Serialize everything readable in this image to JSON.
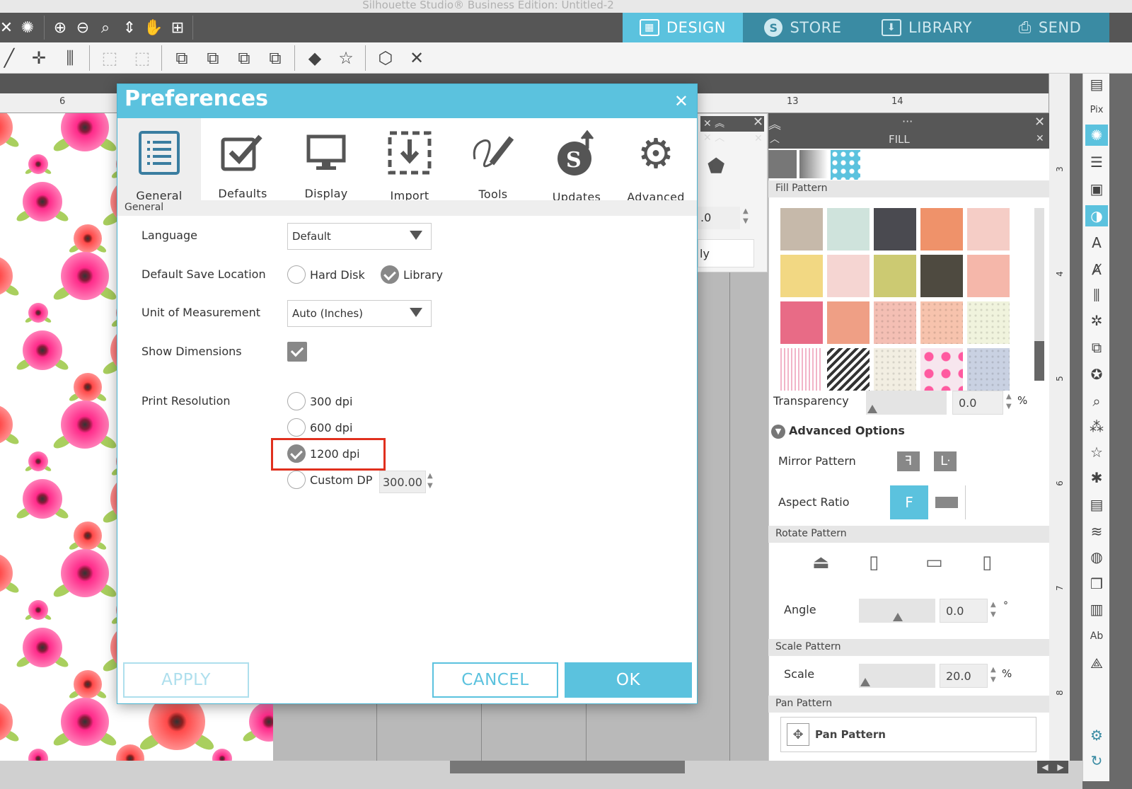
{
  "window_title": "Silhouette Studio® Business Edition: Untitled-2",
  "nav_tabs": [
    {
      "label": "DESIGN",
      "icon": "grid-icon",
      "active": true
    },
    {
      "label": "STORE",
      "icon": "store-s-icon",
      "active": false
    },
    {
      "label": "LIBRARY",
      "icon": "library-download-icon",
      "active": false
    },
    {
      "label": "SEND",
      "icon": "printer-icon",
      "active": false
    }
  ],
  "ruler": {
    "h_numbers": [
      "6",
      "13",
      "14"
    ],
    "v_numbers": [
      "3",
      "4",
      "5",
      "6",
      "7",
      "8"
    ]
  },
  "dialog": {
    "title": "Preferences",
    "tabs": [
      {
        "label": "General",
        "icon": "list-icon"
      },
      {
        "label": "Defaults",
        "icon": "checkbox-icon"
      },
      {
        "label": "Display",
        "icon": "monitor-icon"
      },
      {
        "label": "Import",
        "icon": "import-icon"
      },
      {
        "label": "Tools",
        "icon": "pen-icon"
      },
      {
        "label": "Updates",
        "icon": "updates-icon"
      },
      {
        "label": "Advanced",
        "icon": "gear-icon"
      }
    ],
    "breadcrumb": "General",
    "language": {
      "label": "Language",
      "value": "Default"
    },
    "save_location": {
      "label": "Default Save Location",
      "opt1": "Hard Disk",
      "opt2": "Library",
      "selected": "Library"
    },
    "unit": {
      "label": "Unit of Measurement",
      "value": "Auto (Inches)"
    },
    "dimensions": {
      "label": "Show Dimensions",
      "checked": true
    },
    "print_resolution": {
      "label": "Print Resolution",
      "opt1": "300 dpi",
      "opt2": "600 dpi",
      "opt3": "1200 dpi",
      "opt4": "Custom DP",
      "custom_value": "300.00",
      "selected": "1200 dpi"
    },
    "buttons": {
      "apply": "APPLY",
      "cancel": "CANCEL",
      "ok": "OK"
    }
  },
  "mid_panel": {
    "value": ".0",
    "text": "ly"
  },
  "fill_panel": {
    "header": "FILL",
    "section_fill_pattern": "Fill Pattern",
    "transparency": {
      "label": "Transparency",
      "value": "0.0",
      "unit": "%"
    },
    "advanced_options": "Advanced Options",
    "mirror_pattern": "Mirror Pattern",
    "aspect_ratio": "Aspect Ratio",
    "section_rotate": "Rotate Pattern",
    "angle": {
      "label": "Angle",
      "value": "0.0",
      "unit": "°"
    },
    "section_scale": "Scale Pattern",
    "scale": {
      "label": "Scale",
      "value": "20.0",
      "unit": "%"
    },
    "section_pan": "Pan Pattern",
    "pan_button": "Pan Pattern",
    "swatch_colors": [
      "#c6b9aa",
      "#cfe3dc",
      "#4a4a50",
      "#ef926a",
      "#f5cdc6",
      "#f2d883",
      "#f5d5d2",
      "#ccca72",
      "#4e4a40",
      "#f5b7aa",
      "#e86b86",
      "#ef9f85",
      "#f4bfb4",
      "#f7c3ad",
      "#f0f3dd",
      "#f6e4ea",
      "#3f3f3f",
      "#f2eee2",
      "#f7e6ee",
      "#c9d1e2"
    ]
  },
  "colors": {
    "accent": "#5bc2de",
    "highlight": "#e0301e"
  }
}
